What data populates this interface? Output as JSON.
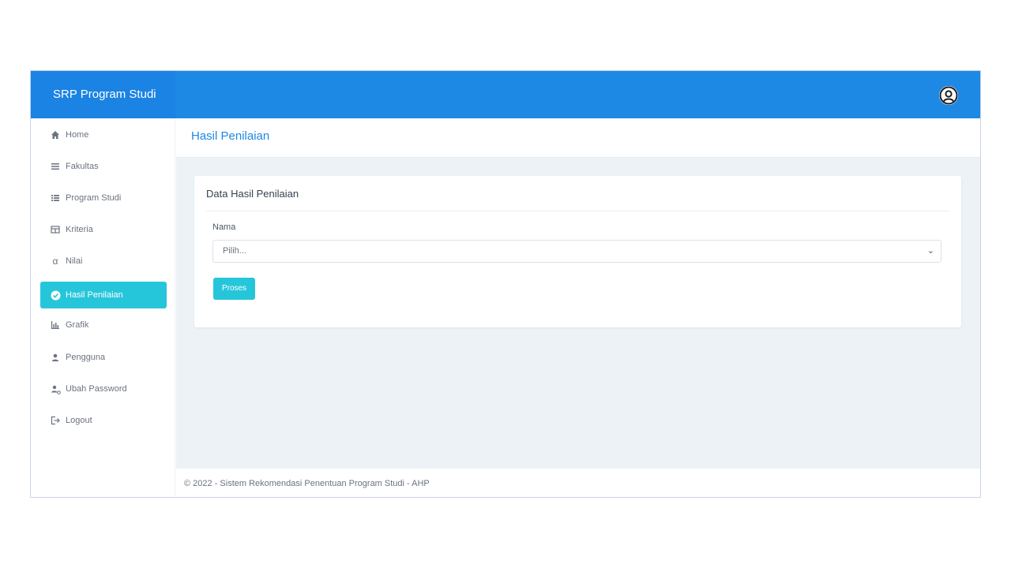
{
  "app": {
    "brand": "SRP Program Studi"
  },
  "header": {
    "user_icon": "user-circle-icon"
  },
  "sidebar": {
    "items": [
      {
        "label": "Home",
        "icon": "home-icon"
      },
      {
        "label": "Fakultas",
        "icon": "list-icon"
      },
      {
        "label": "Program Studi",
        "icon": "list-icon"
      },
      {
        "label": "Kriteria",
        "icon": "table-icon"
      },
      {
        "label": "Nilai",
        "icon": "alpha-icon"
      },
      {
        "label": "Hasil Penilaian",
        "icon": "check-circle-icon",
        "active": true
      },
      {
        "label": "Grafik",
        "icon": "bar-chart-icon"
      },
      {
        "label": "Pengguna",
        "icon": "user-icon"
      },
      {
        "label": "Ubah Password",
        "icon": "user-cog-icon"
      },
      {
        "label": "Logout",
        "icon": "logout-icon"
      }
    ]
  },
  "main": {
    "page_title": "Hasil Penilaian",
    "card": {
      "title": "Data Hasil Penilaian",
      "field_label": "Nama",
      "select_value": "Pilih...",
      "button_label": "Proses"
    }
  },
  "footer": {
    "text": "© 2022 - Sistem Rekomendasi Penentuan Program Studi - AHP"
  },
  "colors": {
    "primary": "#1e88e5",
    "accent": "#26c6da",
    "background": "#ecf2f6"
  }
}
